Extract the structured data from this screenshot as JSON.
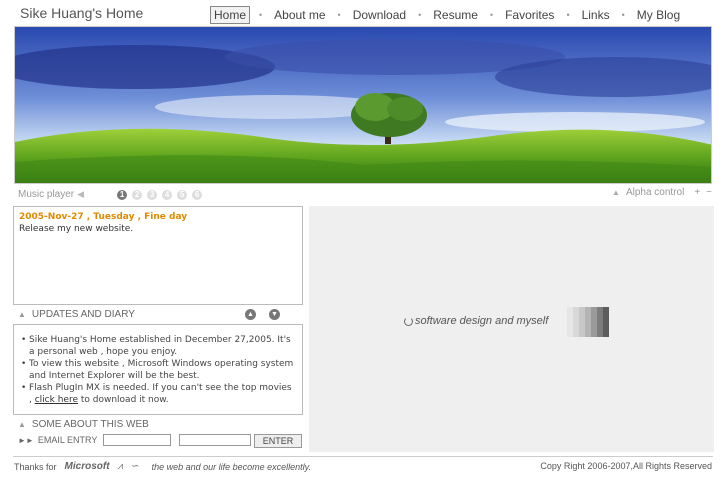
{
  "site_title": "Sike Huang's Home",
  "nav": [
    "Home",
    "About me",
    "Download",
    "Resume",
    "Favorites",
    "Links",
    "My Blog"
  ],
  "music": {
    "label": "Music player",
    "tracks": [
      "1",
      "2",
      "3",
      "4",
      "5",
      "6"
    ]
  },
  "alpha_control": {
    "label": "Alpha control",
    "plus": "+",
    "minus": "−"
  },
  "diary": {
    "title": "2005-Nov-27 , Tuesday , Fine day",
    "text": "Release my new website."
  },
  "updates_heading": "UPDATES AND DIARY",
  "news": {
    "item1": "Sike Huang's Home established in December 27,2005. It's a personal web , hope you enjoy.",
    "item2": "To view this website , Microsoft Windows operating system and Internet Explorer will be the best.",
    "item3_before": "Flash PlugIn MX is needed. If you can't see the top movies , ",
    "item3_link": "click here",
    "item3_after": " to download it now."
  },
  "about_heading": "SOME ABOUT THIS WEB",
  "email": {
    "label": "EMAIL ENTRY",
    "button": "ENTER"
  },
  "loader": {
    "text": "software design and myself"
  },
  "footer": {
    "thanks": "Thanks for",
    "ms": "Microsoft",
    "tagline": "the web and our life become excellently.",
    "copyright": "Copy Right 2006-2007,All Rights Reserved"
  },
  "colors": {
    "accent": "#e08a00"
  }
}
